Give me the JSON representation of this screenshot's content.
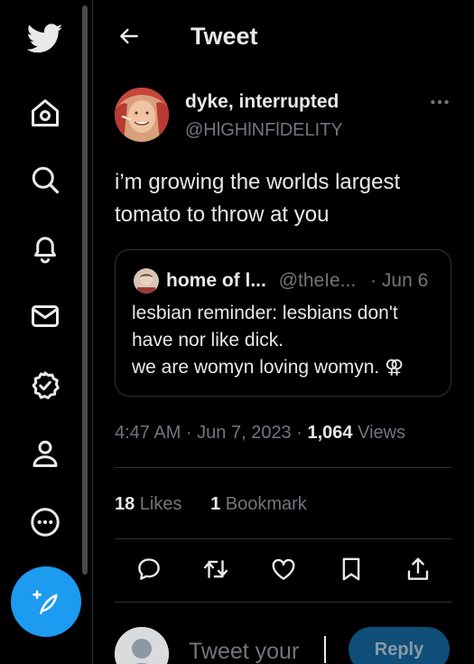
{
  "sidebar": {
    "icons": [
      "twitter-logo",
      "home-icon",
      "search-icon",
      "notifications-icon",
      "messages-icon",
      "verified-icon",
      "profile-icon",
      "more-icon"
    ],
    "compose_icon": "compose-icon"
  },
  "header": {
    "back_icon": "back-arrow-icon",
    "title": "Tweet"
  },
  "tweet": {
    "author_name": "dyke, interrupted",
    "author_handle": "@HlGHlNFlDELITY",
    "more_icon": "more-icon",
    "text": "i’m growing the worlds largest tomato to throw at you",
    "quote": {
      "name": "home of l...",
      "handle": "@theIe...",
      "date": "· Jun 6",
      "text": "lesbian reminder: lesbians don't have nor like dick.\nwe are womyn loving womyn. ⚢"
    },
    "time": "4:47 AM · Jun 7, 2023 · ",
    "views_count": "1,064",
    "views_label": " Views",
    "likes_count": "18",
    "likes_label": " Likes",
    "bookmarks_count": "1",
    "bookmarks_label": " Bookmark"
  },
  "actions": [
    "reply-icon",
    "retweet-icon",
    "like-icon",
    "bookmark-icon",
    "share-icon"
  ],
  "reply": {
    "placeholder": "Tweet your",
    "button_label": "Reply"
  },
  "colors": {
    "background": "#000000",
    "accent": "#1d9bf0",
    "text": "#e7e9ea",
    "muted": "#71767b",
    "border": "#2f3336"
  }
}
